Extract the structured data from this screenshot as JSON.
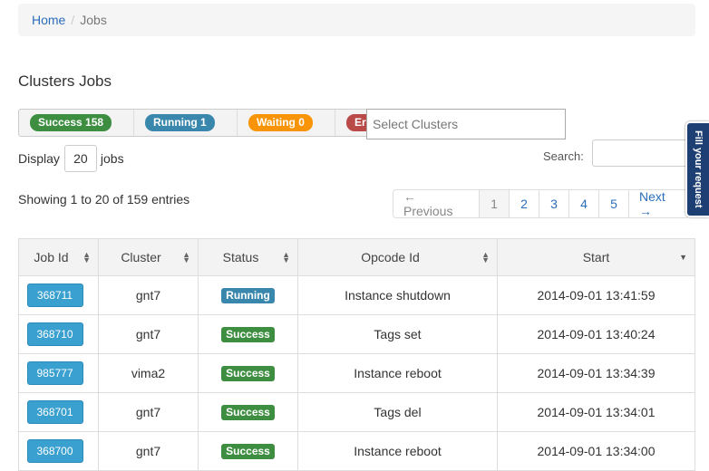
{
  "breadcrumb": {
    "home": "Home",
    "separator": "/",
    "current": "Jobs"
  },
  "page_title": "Clusters Jobs",
  "filters": [
    {
      "label": "Success 158",
      "color": "#3e8e41"
    },
    {
      "label": "Running 1",
      "color": "#3a87ad"
    },
    {
      "label": "Waiting 0",
      "color": "#f89406"
    },
    {
      "label": "Error 0",
      "color": "#b94a48"
    }
  ],
  "select_clusters": {
    "placeholder": "Select Clusters"
  },
  "display": {
    "prefix": "Display",
    "value": "20",
    "suffix": "jobs"
  },
  "search": {
    "label": "Search:",
    "value": ""
  },
  "showing": "Showing 1 to 20 of 159 entries",
  "pagination": [
    "← Previous",
    "1",
    "2",
    "3",
    "4",
    "5",
    "Next →"
  ],
  "feedback_tab": "Fill your request",
  "table": {
    "headers": [
      "Job Id",
      "Cluster",
      "Status",
      "Opcode Id",
      "Start"
    ],
    "rows": [
      {
        "job_id": "368711",
        "cluster": "gnt7",
        "status": "Running",
        "status_color": "#3a87ad",
        "opcode": "Instance shutdown",
        "start": "2014-09-01 13:41:59"
      },
      {
        "job_id": "368710",
        "cluster": "gnt7",
        "status": "Success",
        "status_color": "#3e8e41",
        "opcode": "Tags set",
        "start": "2014-09-01 13:40:24"
      },
      {
        "job_id": "985777",
        "cluster": "vima2",
        "status": "Success",
        "status_color": "#3e8e41",
        "opcode": "Instance reboot",
        "start": "2014-09-01 13:34:39"
      },
      {
        "job_id": "368701",
        "cluster": "gnt7",
        "status": "Success",
        "status_color": "#3e8e41",
        "opcode": "Tags del",
        "start": "2014-09-01 13:34:01"
      },
      {
        "job_id": "368700",
        "cluster": "gnt7",
        "status": "Success",
        "status_color": "#3e8e41",
        "opcode": "Instance reboot",
        "start": "2014-09-01 13:34:00"
      }
    ]
  }
}
